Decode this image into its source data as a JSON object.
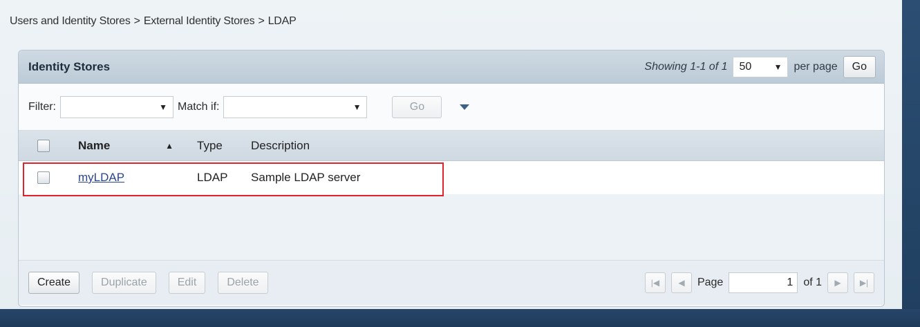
{
  "breadcrumb": {
    "items": [
      "Users and Identity Stores",
      "External Identity Stores",
      "LDAP"
    ],
    "separator": ">"
  },
  "panel": {
    "title": "Identity Stores",
    "pager": {
      "showing": "Showing 1-1 of 1",
      "per_page_value": "50",
      "per_page_label": "per page",
      "go_label": "Go"
    }
  },
  "filter": {
    "label": "Filter:",
    "value": "",
    "match_label": "Match if:",
    "match_value": "",
    "go_label": "Go"
  },
  "table": {
    "columns": [
      "Name",
      "Type",
      "Description"
    ],
    "rows": [
      {
        "name": "myLDAP",
        "type": "LDAP",
        "description": "Sample LDAP server"
      }
    ]
  },
  "footer": {
    "buttons": [
      "Create",
      "Duplicate",
      "Edit",
      "Delete"
    ],
    "page_label": "Page",
    "page_value": "1",
    "page_of": "of 1"
  },
  "icons": {
    "first": "first-page-icon",
    "prev": "prev-page-icon",
    "next": "next-page-icon",
    "last": "last-page-icon",
    "sort": "sort-ascending-icon",
    "filter_toggle": "filter-toggle-icon"
  },
  "colors": {
    "highlight_border": "#e0232a",
    "link": "#29468c",
    "header_bg": "#bccbd7"
  }
}
